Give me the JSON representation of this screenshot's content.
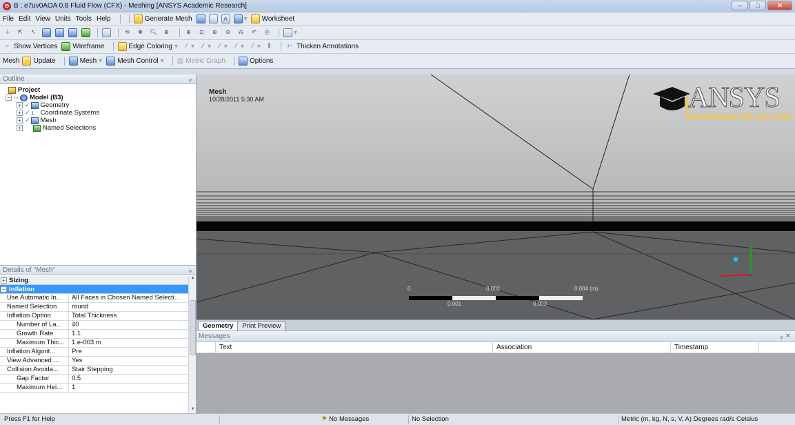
{
  "window": {
    "title": "B : e7uv0AOA 0.8 Fluid Flow (CFX) - Meshing [ANSYS Academic Research]",
    "icon": "ansys-app-icon",
    "buttons": {
      "minimize": "–",
      "maximize": "□",
      "close": "✕"
    }
  },
  "menu": [
    "File",
    "Edit",
    "View",
    "Units",
    "Tools",
    "Help"
  ],
  "toolbar1": {
    "generate_mesh": "Generate Mesh",
    "worksheet": "Worksheet"
  },
  "toolbar3": {
    "show_vertices": "Show Vertices",
    "wireframe": "Wireframe",
    "edge_coloring": "Edge Coloring",
    "thicken_annotations": "Thicken Annotations"
  },
  "toolbar4": {
    "mesh": "Mesh",
    "update": "Update",
    "mesh_dropdown": "Mesh",
    "mesh_control": "Mesh Control",
    "metric_graph": "Metric Graph",
    "options": "Options"
  },
  "outline": {
    "header": "Outline",
    "pin": "ᵩ",
    "project": "Project",
    "model": "Model (B3)",
    "children": [
      "Geometry",
      "Coordinate Systems",
      "Mesh",
      "Named Selections"
    ]
  },
  "details": {
    "header": "Details of \"Mesh\"",
    "pin": "ᵩ",
    "groups": {
      "sizing": "Sizing",
      "inflation": "Inflation"
    },
    "rows": [
      {
        "key": "Use Automatic In...",
        "value": "All Faces in Chosen Named Selecti..."
      },
      {
        "key": "Named Selection",
        "value": "round"
      },
      {
        "key": "Inflation Option",
        "value": "Total Thickness"
      },
      {
        "key": "Number of La...",
        "value": "40"
      },
      {
        "key": "Growth Rate",
        "value": "1.1"
      },
      {
        "key": "Maximum Thic...",
        "value": "1.e-003 m"
      },
      {
        "key": "Inflation Algorit...",
        "value": "Pre"
      },
      {
        "key": "View Advanced ...",
        "value": "Yes"
      },
      {
        "key": "Collision Avoida...",
        "value": "Stair Stepping"
      },
      {
        "key": "Gap Factor",
        "value": "0.5"
      },
      {
        "key": "Maximum Hei...",
        "value": "1"
      }
    ]
  },
  "viewport": {
    "title": "Mesh",
    "date": "10/28/2011 5:30 AM",
    "logo": "ANSYS",
    "logo_sub": "Noncommercial use only",
    "scale": {
      "l0": "0",
      "l1": "0.002",
      "l2": "0.004 (m)",
      "l3": "0.001",
      "l4": "0.003"
    },
    "bg_color": "#b8babc"
  },
  "tabs": [
    "Geometry",
    "Print Preview"
  ],
  "messages": {
    "header": "Messages",
    "pin": "ᵩ ✕",
    "cols": [
      "Text",
      "Association",
      "Timestamp"
    ]
  },
  "status": {
    "help": "Press F1 for Help",
    "messages": "No Messages",
    "selection": "No Selection",
    "units": "Metric (m, kg, N, s, V, A)   Degrees   rad/s   Celsius"
  }
}
